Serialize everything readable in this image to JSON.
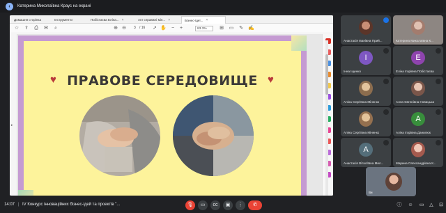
{
  "banner": {
    "text": "Катерина Миколаївна Краус на екрані",
    "icon": "present-icon"
  },
  "pdf": {
    "tabs": [
      {
        "label": "Домашня сторінка"
      },
      {
        "label": "Інструменти"
      },
      {
        "label": "Побістаєва Еліна..."
      },
      {
        "label": "Акт справжні мін..."
      },
      {
        "label": "Бізнес-ідеї..."
      }
    ],
    "page_current": "3",
    "page_total": "/ 16",
    "zoom": "83.3%"
  },
  "slide": {
    "title": "ПРАВОВЕ СЕРЕДОВИЩЕ",
    "heart_glyph": "♥"
  },
  "participants": [
    {
      "name": "Анастасія Іванівна Прий...",
      "type": "photo",
      "color": "#7a4a3a",
      "speaking": true
    },
    {
      "name": "Катерина Миколаївна К...",
      "type": "photo",
      "color": "#c9b2b0",
      "speaking": false
    },
    {
      "name": "Інна Іщенко",
      "type": "avatar",
      "initial": "I",
      "color": "#7e57c2"
    },
    {
      "name": "Еліна Ігорівна Побістаєва",
      "type": "avatar",
      "initial": "E",
      "color": "#8e44ad"
    },
    {
      "name": "Аліна Сергіївна Міненко",
      "type": "photo",
      "color": "#b08a6a"
    },
    {
      "name": "Алла Євгенівна Новицька",
      "type": "photo",
      "color": "#a98374"
    },
    {
      "name": "Аліна Сергіївна Міненко",
      "type": "photo",
      "color": "#b8956e"
    },
    {
      "name": "Аліна Ігорівна Данилюк",
      "type": "avatar",
      "initial": "A",
      "color": "#388e3c"
    },
    {
      "name": "Анастасія Віталіївна Мел...",
      "type": "avatar",
      "initial": "A",
      "color": "#546e7a"
    },
    {
      "name": "Марина Олександрівна К...",
      "type": "photo",
      "color": "#c98a7a"
    }
  ],
  "self": {
    "name": "Ви"
  },
  "bottombar": {
    "time": "14:07",
    "meeting_title": "IV Конкурс інноваційних бізнес-ідей та проектів \"..."
  },
  "colors": {
    "slide_bg": "#fdf39b",
    "slide_border": "#c59bd2",
    "end_call": "#ea4335",
    "meet_bg": "#202124"
  }
}
